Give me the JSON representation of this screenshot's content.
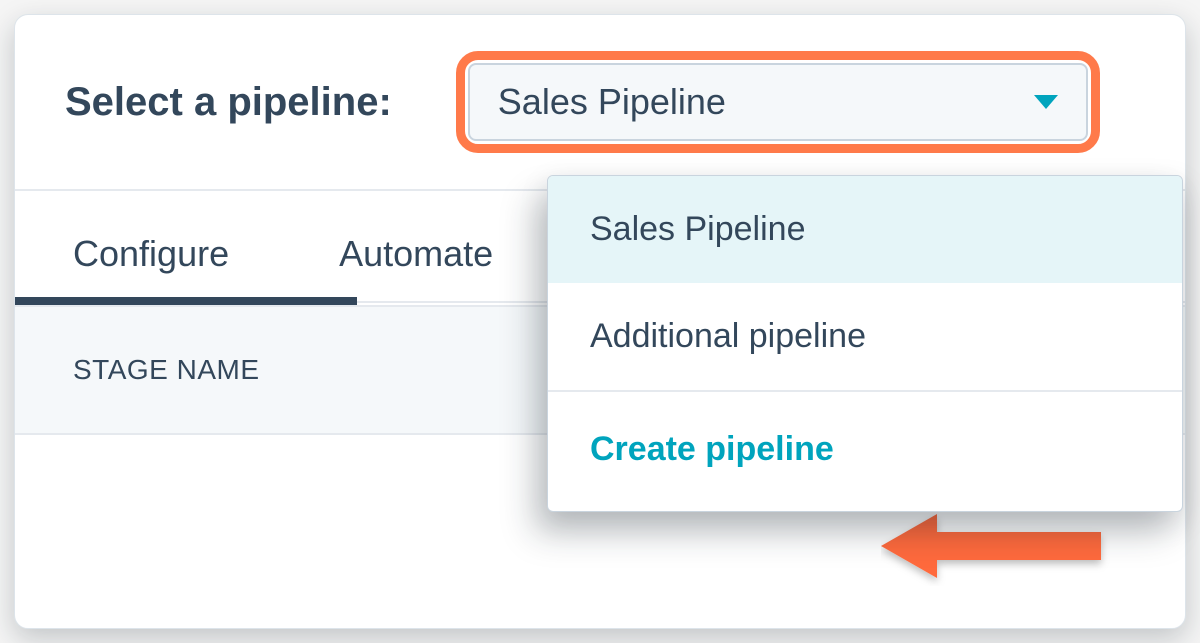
{
  "header": {
    "label": "Select a pipeline:"
  },
  "select": {
    "value": "Sales Pipeline"
  },
  "tabs": {
    "items": [
      {
        "label": "Configure",
        "active": true
      },
      {
        "label": "Automate",
        "active": false
      }
    ]
  },
  "columns": {
    "stage_name": "STAGE NAME"
  },
  "dropdown": {
    "options": [
      {
        "label": "Sales Pipeline",
        "selected": true
      },
      {
        "label": "Additional pipeline",
        "selected": false
      }
    ],
    "create_label": "Create pipeline"
  },
  "colors": {
    "text": "#33475b",
    "accent": "#00a4bd",
    "highlight": "#ff7a4a",
    "panel_bg": "#f5f8fa"
  }
}
